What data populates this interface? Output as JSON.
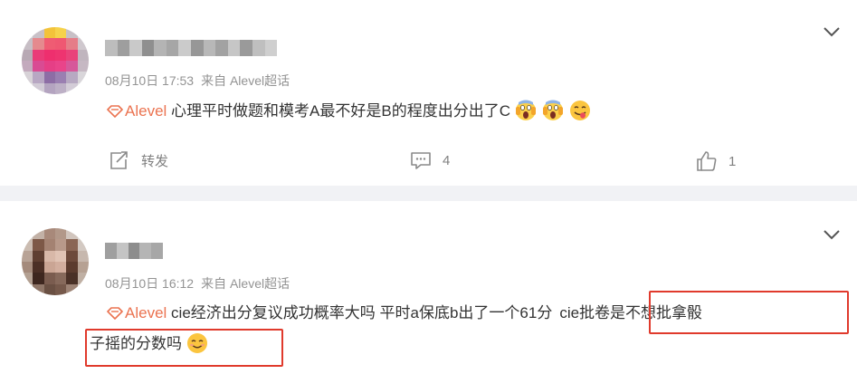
{
  "posts": [
    {
      "timestamp": "08月10日 17:53",
      "source": "来自 Alevel超话",
      "tag": "Alevel",
      "text": "心理平时做题和模考A最不好是B的程度出分出了C",
      "actions": {
        "repost_label": "转发",
        "comment_count": "4",
        "like_count": "1"
      },
      "emoji_names": [
        "screaming-face-emoji",
        "screaming-face-emoji",
        "tongue-face-emoji"
      ]
    },
    {
      "timestamp": "08月10日 16:12",
      "source": "来自 Alevel超话",
      "tag": "Alevel",
      "text_line1_a": "cie经济出分复议成功概率大吗 平时a保底b出了一个61分",
      "text_line1_b": "cie批卷是不想批拿骰",
      "text_line2": "子摇的分数吗",
      "emoji_names": [
        "smiling-face-emoji"
      ]
    }
  ],
  "colors": {
    "accent": "#eb7350",
    "highlight_box": "#e03a2c",
    "meta": "#939393",
    "text": "#333333"
  }
}
